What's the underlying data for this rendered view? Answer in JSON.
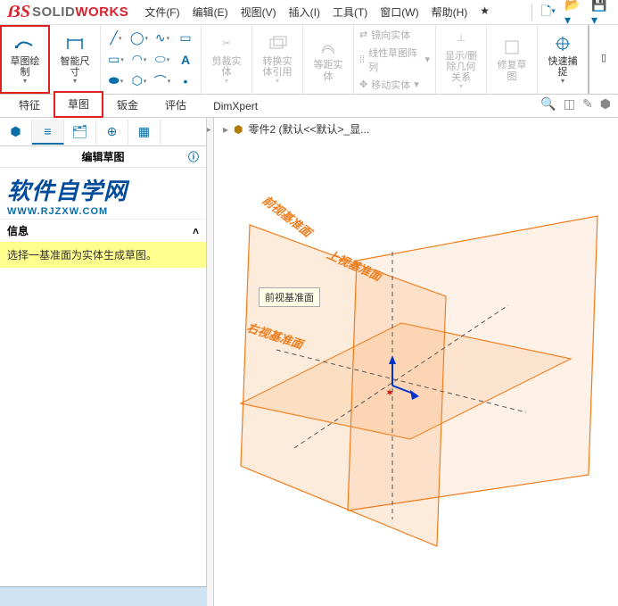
{
  "app": {
    "solid": "SOLID",
    "works": "WORKS"
  },
  "menu": {
    "file": "文件(F)",
    "edit": "编辑(E)",
    "view": "视图(V)",
    "insert": "插入(I)",
    "tools": "工具(T)",
    "window": "窗口(W)",
    "help": "帮助(H)"
  },
  "ribbon": {
    "sketch": "草图绘\n制",
    "smartdim": "智能尺\n寸",
    "trim": "剪裁实\n体",
    "convert": "转换实\n体引用",
    "offset": "等距实\n体",
    "mirror": "镜向实体",
    "linpat": "线性草图阵列",
    "move": "移动实体",
    "showrel": "显示/删\n除几何\n关系",
    "repair": "修复草\n图",
    "quicksnap": "快速捕\n捉"
  },
  "tabs": {
    "feature": "特征",
    "sketch": "草图",
    "sheet": "钣金",
    "eval": "评估",
    "dimxpert": "DimXpert"
  },
  "panel": {
    "edit_sketch": "编辑草图",
    "brand_cn": "软件自学网",
    "brand_url": "WWW.RJZXW.COM",
    "info": "信息",
    "select_plane": "选择一基准面为实体生成草图。"
  },
  "viewport": {
    "breadcrumb": "零件2  (默认<<默认>_显...",
    "tooltip": "前视基准面",
    "plane_front": "前视基准面",
    "plane_top": "上视基准面",
    "plane_right": "右视基准面"
  }
}
